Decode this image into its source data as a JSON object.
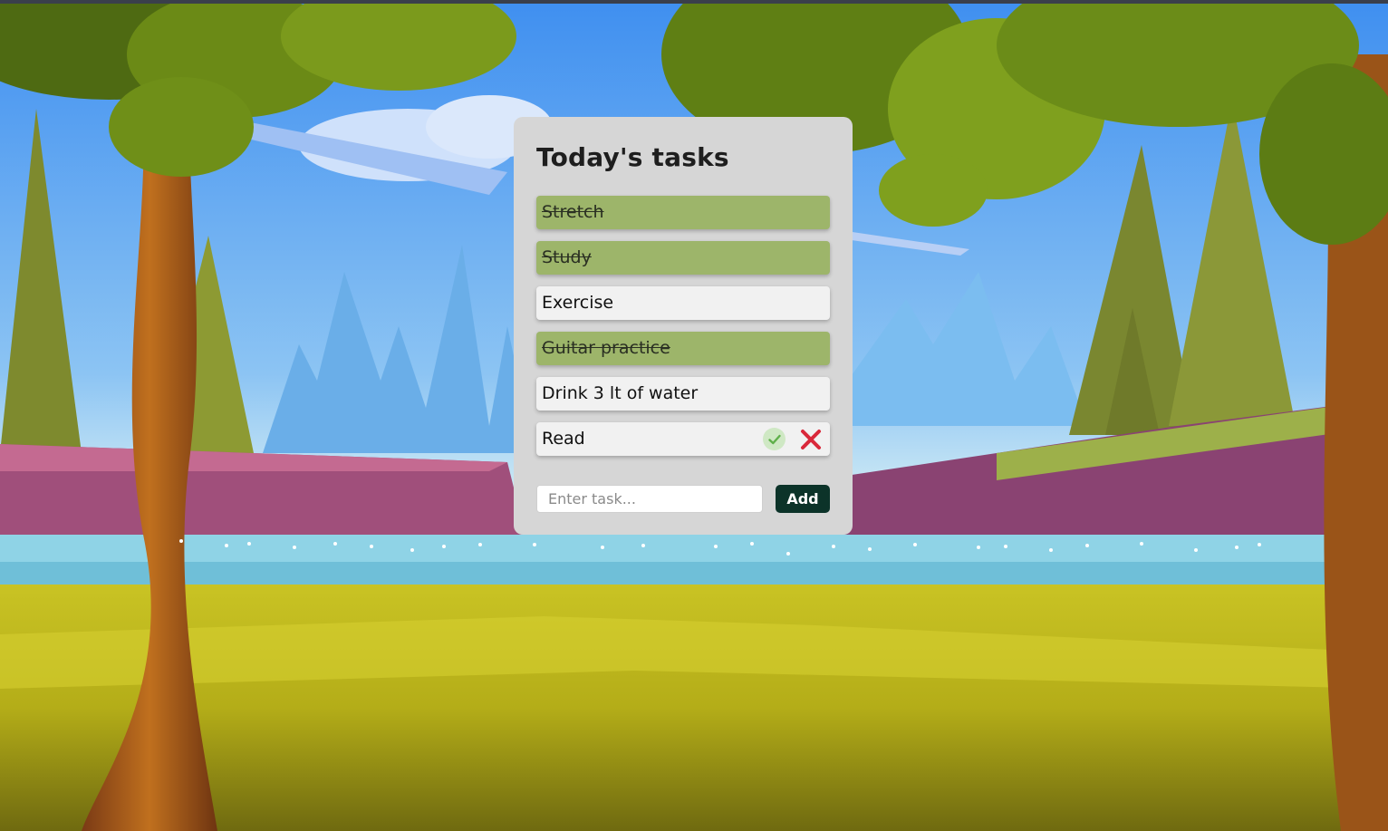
{
  "app": {
    "title": "Today's tasks"
  },
  "tasks": [
    {
      "label": "Stretch",
      "done": true
    },
    {
      "label": "Study",
      "done": true
    },
    {
      "label": "Exercise",
      "done": false
    },
    {
      "label": "Guitar practice",
      "done": true
    },
    {
      "label": "Drink 3 lt of water",
      "done": false
    },
    {
      "label": "Read",
      "done": false,
      "hovered": true
    }
  ],
  "add_form": {
    "placeholder": "Enter task...",
    "value": "",
    "button_label": "Add"
  },
  "icons": {
    "complete": "check-icon",
    "delete": "close-icon"
  },
  "colors": {
    "card_bg": "#d6d6d6",
    "task_bg": "#f1f1f1",
    "task_done_bg": "#9db56a",
    "add_button_bg": "#0c3329",
    "check_green": "#5fb04a",
    "delete_red": "#d9283a"
  }
}
